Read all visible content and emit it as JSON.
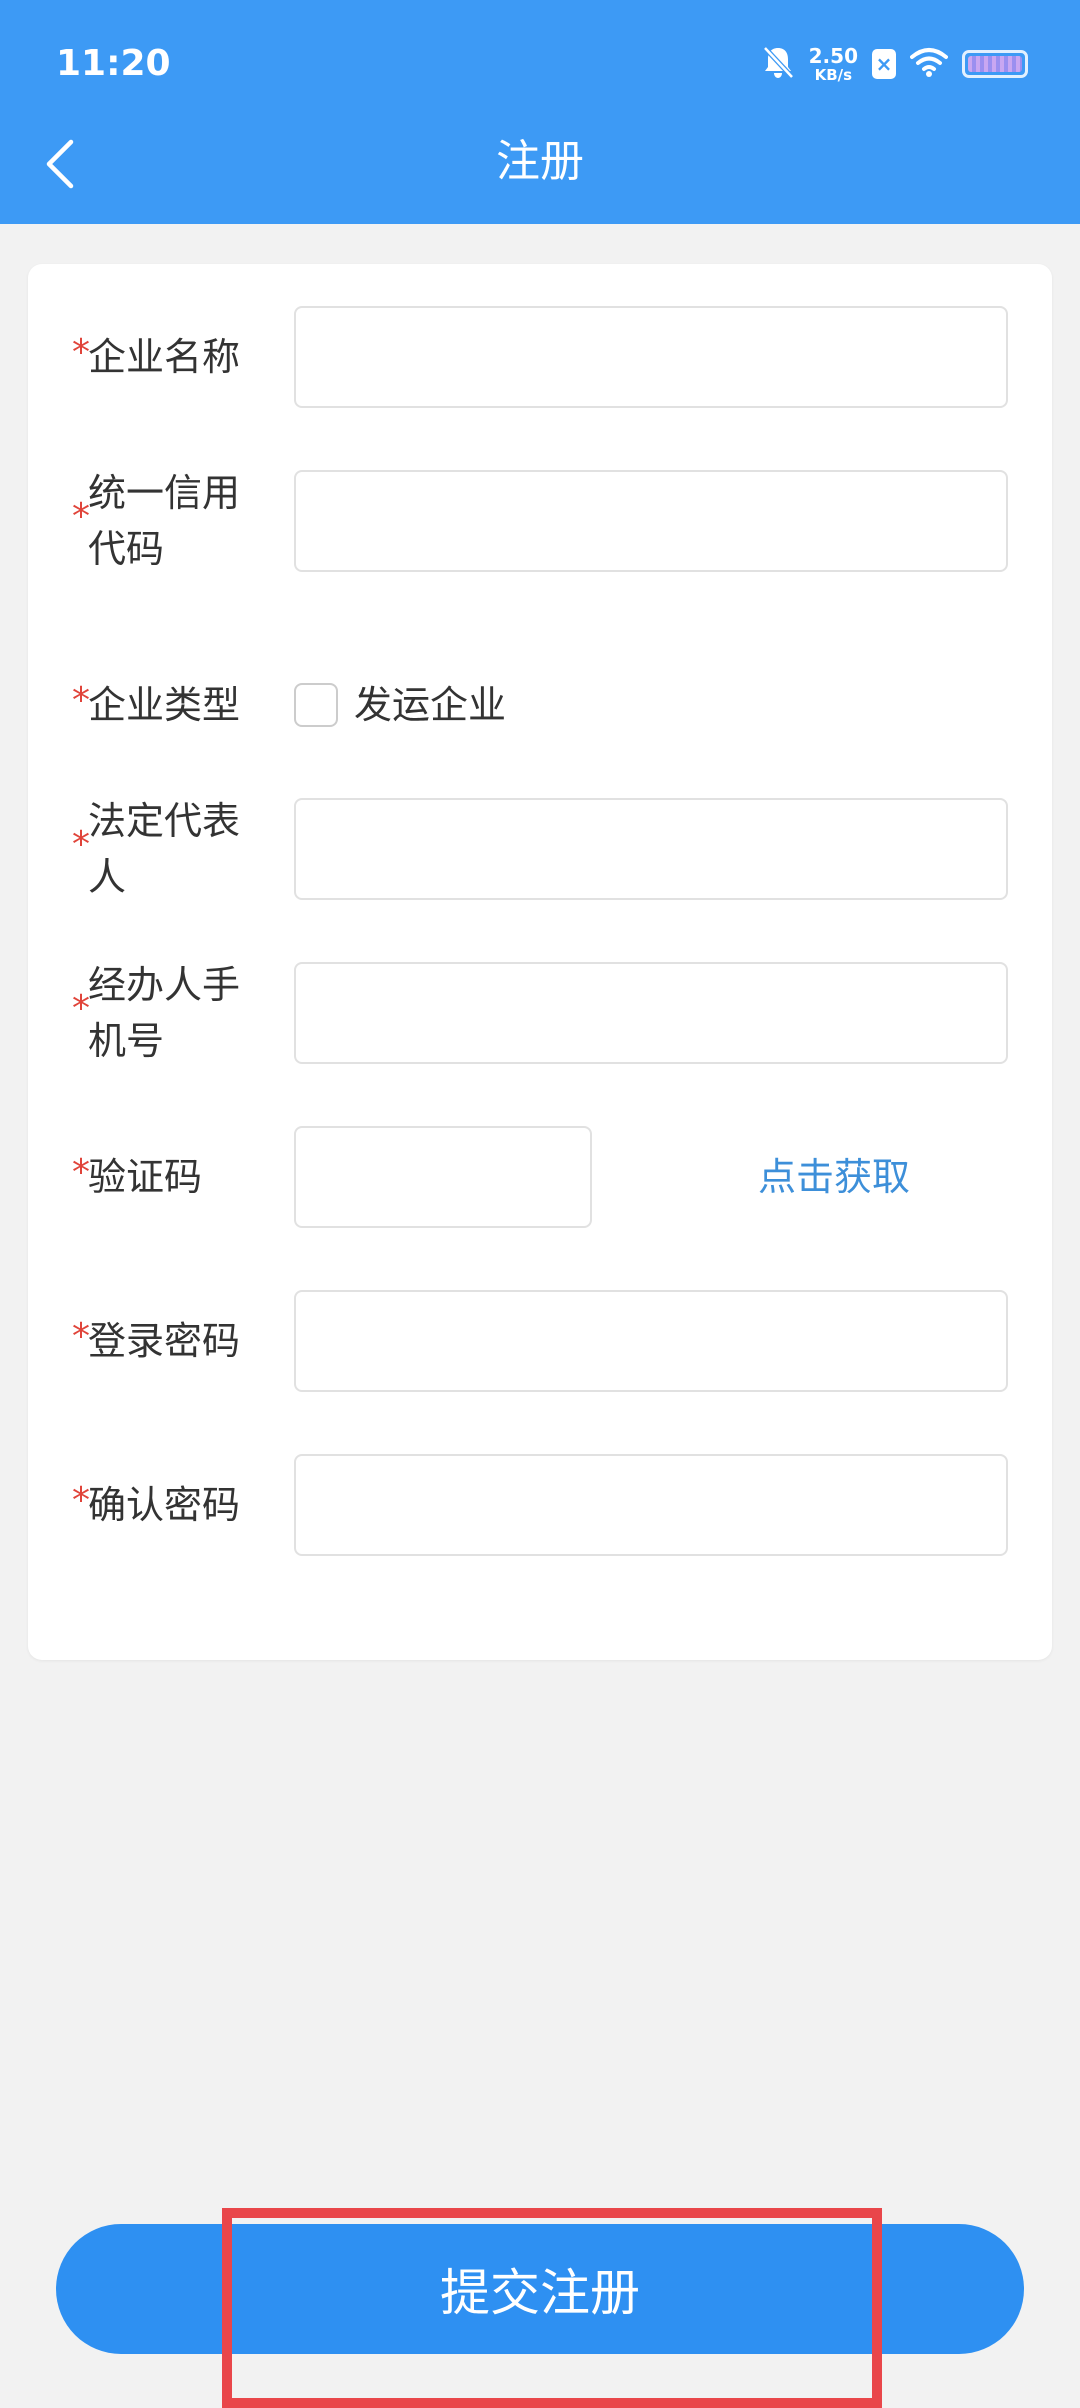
{
  "status_bar": {
    "time": "11:20",
    "net_speed_value": "2.50",
    "net_speed_unit": "KB/s",
    "sim_badge": "×",
    "icons": [
      "bell-off-icon",
      "sim-icon",
      "wifi-icon",
      "battery-icon"
    ]
  },
  "header": {
    "title": "注册",
    "back_icon": "chevron-left-icon",
    "background_color": "#3d9af5"
  },
  "form": {
    "required_mark": "*",
    "company_name_label": "企业名称",
    "credit_code_label": "统一信用代码",
    "company_type_label": "企业类型",
    "company_type_option": "发运企业",
    "legal_rep_label": "法定代表人",
    "operator_phone_label": "经办人手机号",
    "verify_code_label": "验证码",
    "get_code_label": "点击获取",
    "login_password_label": "登录密码",
    "confirm_password_label": "确认密码"
  },
  "submit": {
    "label": "提交注册",
    "color": "#2e90f2"
  },
  "highlight_color": "#e9464a"
}
